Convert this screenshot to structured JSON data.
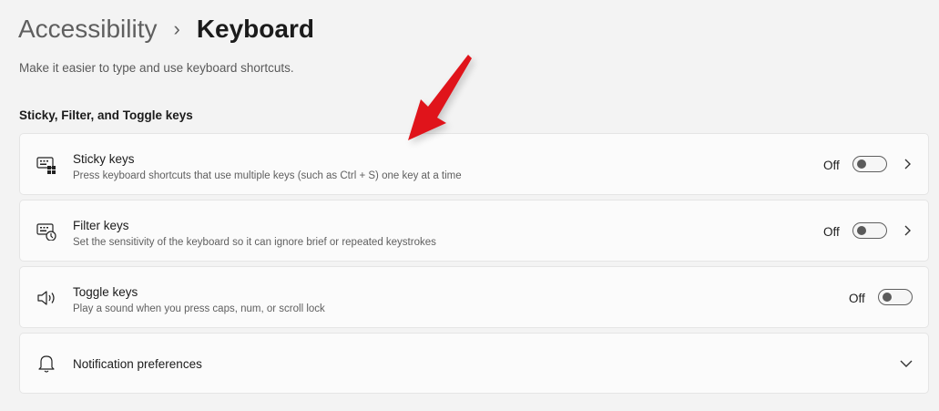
{
  "breadcrumb": {
    "parent": "Accessibility",
    "separator": "›",
    "current": "Keyboard"
  },
  "subtitle": "Make it easier to type and use keyboard shortcuts.",
  "section_title": "Sticky, Filter, and Toggle keys",
  "settings": [
    {
      "icon": "sticky-keys-icon",
      "title": "Sticky keys",
      "description": "Press keyboard shortcuts that use multiple keys (such as Ctrl + S) one key at a time",
      "state": "Off",
      "enabled": false,
      "has_chevron": true
    },
    {
      "icon": "filter-keys-icon",
      "title": "Filter keys",
      "description": "Set the sensitivity of the keyboard so it can ignore brief or repeated keystrokes",
      "state": "Off",
      "enabled": false,
      "has_chevron": true
    },
    {
      "icon": "speaker-icon",
      "title": "Toggle keys",
      "description": "Play a sound when you press caps, num, or scroll lock",
      "state": "Off",
      "enabled": false,
      "has_chevron": false
    }
  ],
  "notification": {
    "icon": "bell-icon",
    "title": "Notification preferences",
    "expand_icon": "chevron-down-icon"
  },
  "colors": {
    "background": "#f3f3f3",
    "card": "#fbfbfb",
    "annotation_arrow": "#e0141b"
  }
}
